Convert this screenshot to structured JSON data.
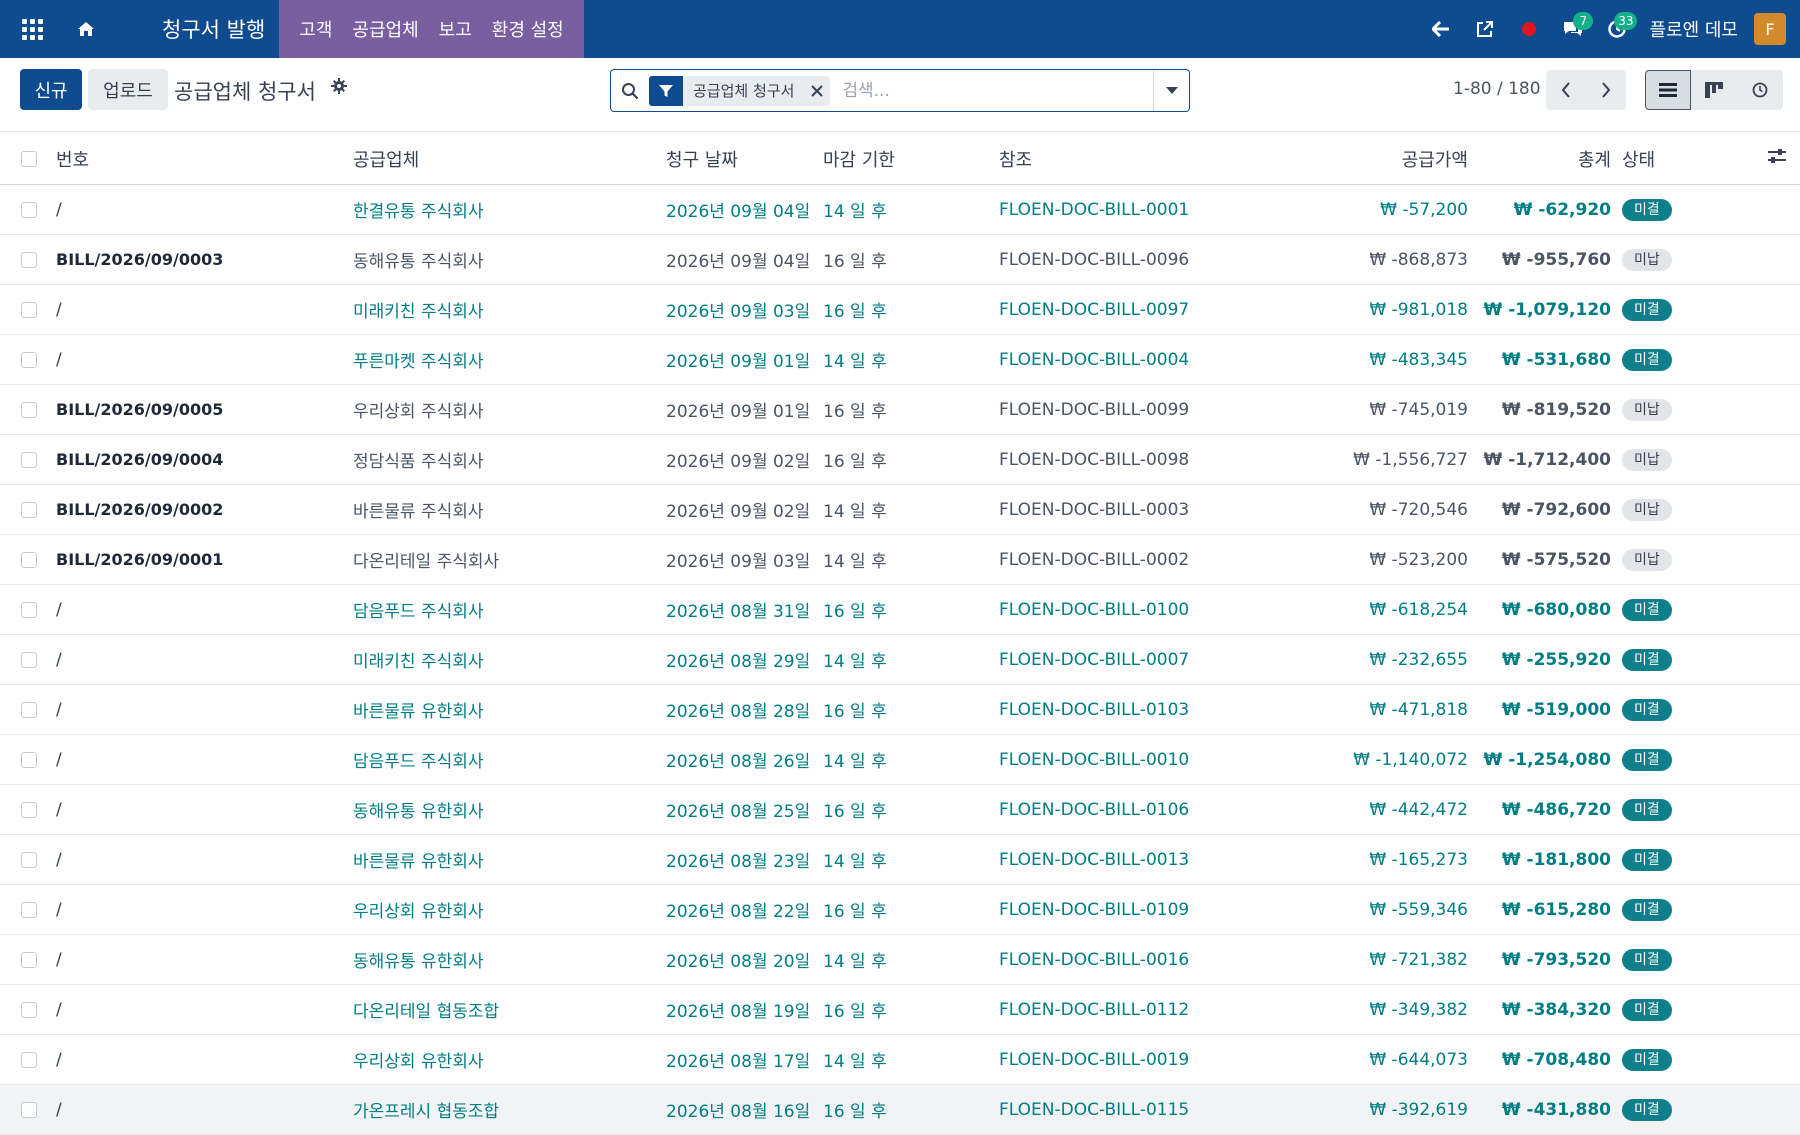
{
  "navbar": {
    "brand": "청구서 발행",
    "menu": [
      "고객",
      "공급업체",
      "보고",
      "환경 설정"
    ],
    "messages_count": "7",
    "activities_count": "33",
    "user_name": "플로엔 데모",
    "avatar_letter": "F",
    "colors": {
      "bar": "#0e4b8f",
      "menu": "#7a5fa0",
      "badge": "#14b08a",
      "record_dot": "#e0151e"
    }
  },
  "control": {
    "new_label": "신규",
    "upload_label": "업로드",
    "breadcrumb": "공급업체 청구서",
    "search_facet": "공급업체 청구서",
    "search_placeholder": "검색...",
    "pager": "1-80 / 180"
  },
  "table": {
    "headers": {
      "number": "번호",
      "vendor": "공급업체",
      "bill_date": "청구 날짜",
      "due": "마감 기한",
      "reference": "참조",
      "untaxed": "공급가액",
      "total": "총계",
      "status": "상태"
    },
    "rows": [
      {
        "number": "/",
        "vendor": "한결유통 주식회사",
        "date": "2026년 09월 04일",
        "due": "14 일 후",
        "ref": "FLOEN-DOC-BILL-0001",
        "untaxed": "₩ -57,200",
        "total": "₩ -62,920",
        "status": "미결",
        "draft": false
      },
      {
        "number": "BILL/2026/09/0003",
        "vendor": "동해유통 주식회사",
        "date": "2026년 09월 04일",
        "due": "16 일 후",
        "ref": "FLOEN-DOC-BILL-0096",
        "untaxed": "₩ -868,873",
        "total": "₩ -955,760",
        "status": "미납",
        "draft": true
      },
      {
        "number": "/",
        "vendor": "미래키친 주식회사",
        "date": "2026년 09월 03일",
        "due": "16 일 후",
        "ref": "FLOEN-DOC-BILL-0097",
        "untaxed": "₩ -981,018",
        "total": "₩ -1,079,120",
        "status": "미결",
        "draft": false
      },
      {
        "number": "/",
        "vendor": "푸른마켓 주식회사",
        "date": "2026년 09월 01일",
        "due": "14 일 후",
        "ref": "FLOEN-DOC-BILL-0004",
        "untaxed": "₩ -483,345",
        "total": "₩ -531,680",
        "status": "미결",
        "draft": false
      },
      {
        "number": "BILL/2026/09/0005",
        "vendor": "우리상회 주식회사",
        "date": "2026년 09월 01일",
        "due": "16 일 후",
        "ref": "FLOEN-DOC-BILL-0099",
        "untaxed": "₩ -745,019",
        "total": "₩ -819,520",
        "status": "미납",
        "draft": true
      },
      {
        "number": "BILL/2026/09/0004",
        "vendor": "정담식품 주식회사",
        "date": "2026년 09월 02일",
        "due": "16 일 후",
        "ref": "FLOEN-DOC-BILL-0098",
        "untaxed": "₩ -1,556,727",
        "total": "₩ -1,712,400",
        "status": "미납",
        "draft": true
      },
      {
        "number": "BILL/2026/09/0002",
        "vendor": "바른물류 주식회사",
        "date": "2026년 09월 02일",
        "due": "14 일 후",
        "ref": "FLOEN-DOC-BILL-0003",
        "untaxed": "₩ -720,546",
        "total": "₩ -792,600",
        "status": "미납",
        "draft": true
      },
      {
        "number": "BILL/2026/09/0001",
        "vendor": "다온리테일 주식회사",
        "date": "2026년 09월 03일",
        "due": "14 일 후",
        "ref": "FLOEN-DOC-BILL-0002",
        "untaxed": "₩ -523,200",
        "total": "₩ -575,520",
        "status": "미납",
        "draft": true
      },
      {
        "number": "/",
        "vendor": "담음푸드 주식회사",
        "date": "2026년 08월 31일",
        "due": "16 일 후",
        "ref": "FLOEN-DOC-BILL-0100",
        "untaxed": "₩ -618,254",
        "total": "₩ -680,080",
        "status": "미결",
        "draft": false
      },
      {
        "number": "/",
        "vendor": "미래키친 주식회사",
        "date": "2026년 08월 29일",
        "due": "14 일 후",
        "ref": "FLOEN-DOC-BILL-0007",
        "untaxed": "₩ -232,655",
        "total": "₩ -255,920",
        "status": "미결",
        "draft": false
      },
      {
        "number": "/",
        "vendor": "바른물류 유한회사",
        "date": "2026년 08월 28일",
        "due": "16 일 후",
        "ref": "FLOEN-DOC-BILL-0103",
        "untaxed": "₩ -471,818",
        "total": "₩ -519,000",
        "status": "미결",
        "draft": false
      },
      {
        "number": "/",
        "vendor": "담음푸드 주식회사",
        "date": "2026년 08월 26일",
        "due": "14 일 후",
        "ref": "FLOEN-DOC-BILL-0010",
        "untaxed": "₩ -1,140,072",
        "total": "₩ -1,254,080",
        "status": "미결",
        "draft": false
      },
      {
        "number": "/",
        "vendor": "동해유통 유한회사",
        "date": "2026년 08월 25일",
        "due": "16 일 후",
        "ref": "FLOEN-DOC-BILL-0106",
        "untaxed": "₩ -442,472",
        "total": "₩ -486,720",
        "status": "미결",
        "draft": false
      },
      {
        "number": "/",
        "vendor": "바른물류 유한회사",
        "date": "2026년 08월 23일",
        "due": "14 일 후",
        "ref": "FLOEN-DOC-BILL-0013",
        "untaxed": "₩ -165,273",
        "total": "₩ -181,800",
        "status": "미결",
        "draft": false
      },
      {
        "number": "/",
        "vendor": "우리상회 유한회사",
        "date": "2026년 08월 22일",
        "due": "16 일 후",
        "ref": "FLOEN-DOC-BILL-0109",
        "untaxed": "₩ -559,346",
        "total": "₩ -615,280",
        "status": "미결",
        "draft": false
      },
      {
        "number": "/",
        "vendor": "동해유통 유한회사",
        "date": "2026년 08월 20일",
        "due": "14 일 후",
        "ref": "FLOEN-DOC-BILL-0016",
        "untaxed": "₩ -721,382",
        "total": "₩ -793,520",
        "status": "미결",
        "draft": false
      },
      {
        "number": "/",
        "vendor": "다온리테일 협동조합",
        "date": "2026년 08월 19일",
        "due": "16 일 후",
        "ref": "FLOEN-DOC-BILL-0112",
        "untaxed": "₩ -349,382",
        "total": "₩ -384,320",
        "status": "미결",
        "draft": false
      },
      {
        "number": "/",
        "vendor": "우리상회 유한회사",
        "date": "2026년 08월 17일",
        "due": "14 일 후",
        "ref": "FLOEN-DOC-BILL-0019",
        "untaxed": "₩ -644,073",
        "total": "₩ -708,480",
        "status": "미결",
        "draft": false
      },
      {
        "number": "/",
        "vendor": "가온프레시 협동조합",
        "date": "2026년 08월 16일",
        "due": "16 일 후",
        "ref": "FLOEN-DOC-BILL-0115",
        "untaxed": "₩ -392,619",
        "total": "₩ -431,880",
        "status": "미결",
        "draft": false
      }
    ]
  }
}
